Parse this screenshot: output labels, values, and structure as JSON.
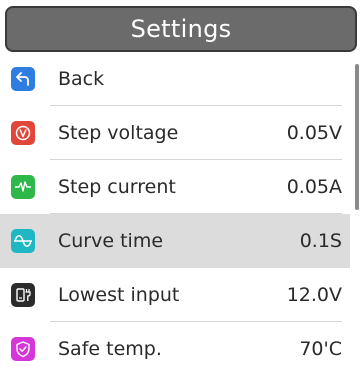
{
  "header": {
    "title": "Settings"
  },
  "menu": {
    "items": [
      {
        "label": "Back",
        "value": "",
        "icon": "back-arrow-icon",
        "icon_color": "#2f7de1"
      },
      {
        "label": "Step voltage",
        "value": "0.05V",
        "icon": "voltage-icon",
        "icon_color": "#e0473a"
      },
      {
        "label": "Step current",
        "value": "0.05A",
        "icon": "current-waveform-icon",
        "icon_color": "#2fb84a"
      },
      {
        "label": "Curve time",
        "value": "0.1S",
        "icon": "sine-wave-icon",
        "icon_color": "#1fb7c4"
      },
      {
        "label": "Lowest input",
        "value": "12.0V",
        "icon": "power-adapter-icon",
        "icon_color": "#2b2b2b"
      },
      {
        "label": "Safe temp.",
        "value": "70'C",
        "icon": "shield-icon",
        "icon_color": "#d536d8"
      }
    ],
    "selected_index": 3
  }
}
